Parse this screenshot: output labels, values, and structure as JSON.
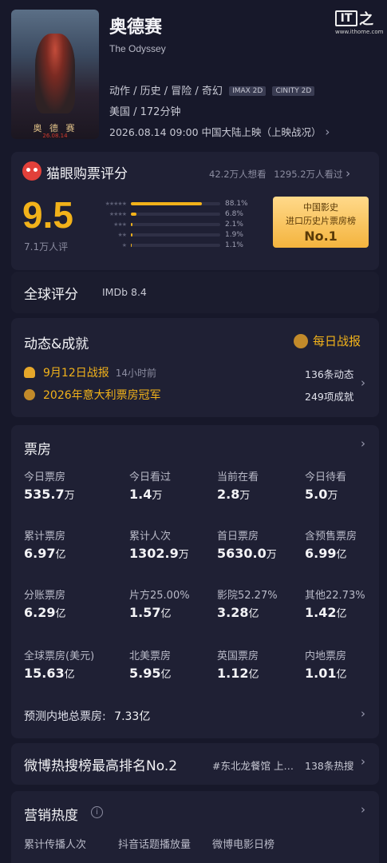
{
  "movie": {
    "title": "奥德赛",
    "subtitle": "The Odyssey",
    "genres": "动作 / 历史 / 冒险 / 奇幻",
    "tags": [
      "IMAX 2D",
      "CINITY 2D"
    ],
    "region": "美国 / 172分钟",
    "release": "2026.08.14 09:00  中国大陆上映（上映战况）",
    "poster_title": "奥 德 赛",
    "poster_date": "26.08.14"
  },
  "watermark": {
    "logo": "IT之家",
    "url": "www.ithome.com"
  },
  "rating": {
    "title": "猫眼购票评分",
    "want": "42.2万人想看",
    "watched": "1295.2万人看过",
    "score": "9.5",
    "count": "7.1万人评",
    "distribution": [
      {
        "stars": 5,
        "pct": "88.1%",
        "value": 88.1
      },
      {
        "stars": 4,
        "pct": "6.8%",
        "value": 6.8
      },
      {
        "stars": 3,
        "pct": "2.1%",
        "value": 2.1
      },
      {
        "stars": 2,
        "pct": "1.9%",
        "value": 1.9
      },
      {
        "stars": 1,
        "pct": "1.1%",
        "value": 1.1
      }
    ],
    "badge_line1": "中国影史",
    "badge_line2": "进口历史片票房榜",
    "badge_line3": "No.1"
  },
  "global": {
    "title": "全球评分",
    "imdb": "IMDb 8.4"
  },
  "news": {
    "title": "动态&成就",
    "daily": "每日战报",
    "item1": "9月12日战报",
    "item1_time": "14小时前",
    "item1_count": "136条动态",
    "item2": "2026年意大利票房冠军",
    "item2_count": "249项成就"
  },
  "boxoffice": {
    "title": "票房",
    "rows": [
      [
        {
          "label": "今日票房",
          "num": "535.7",
          "unit": "万"
        },
        {
          "label": "今日看过",
          "num": "1.4",
          "unit": "万"
        },
        {
          "label": "当前在看",
          "num": "2.8",
          "unit": "万"
        },
        {
          "label": "今日待看",
          "num": "5.0",
          "unit": "万"
        }
      ],
      [
        {
          "label": "累计票房",
          "num": "6.97",
          "unit": "亿"
        },
        {
          "label": "累计人次",
          "num": "1302.9",
          "unit": "万"
        },
        {
          "label": "首日票房",
          "num": "5630.0",
          "unit": "万"
        },
        {
          "label": "含预售票房",
          "num": "6.99",
          "unit": "亿"
        }
      ],
      [
        {
          "label": "分账票房",
          "num": "6.29",
          "unit": "亿"
        },
        {
          "label": "片方25.00%",
          "num": "1.57",
          "unit": "亿"
        },
        {
          "label": "影院52.27%",
          "num": "3.28",
          "unit": "亿"
        },
        {
          "label": "其他22.73%",
          "num": "1.42",
          "unit": "亿"
        }
      ],
      [
        {
          "label": "全球票房(美元)",
          "num": "15.63",
          "unit": "亿"
        },
        {
          "label": "北美票房",
          "num": "5.95",
          "unit": "亿"
        },
        {
          "label": "英国票房",
          "num": "1.12",
          "unit": "亿"
        },
        {
          "label": "内地票房",
          "num": "1.01",
          "unit": "亿"
        }
      ]
    ],
    "forecast_label": "预测内地总票房:",
    "forecast_value": "7.33亿"
  },
  "weibo": {
    "title": "微博热搜榜最高排名No.2",
    "topic": "#东北龙餐馆 上…",
    "count": "138条热搜"
  },
  "marketing": {
    "title": "营销热度",
    "cols": [
      "累计传播人次",
      "抖音话题播放量",
      "微博电影日榜"
    ]
  },
  "colors": {
    "accent": "#f2b21a",
    "background": "#17182a",
    "card": "#1f2034"
  }
}
